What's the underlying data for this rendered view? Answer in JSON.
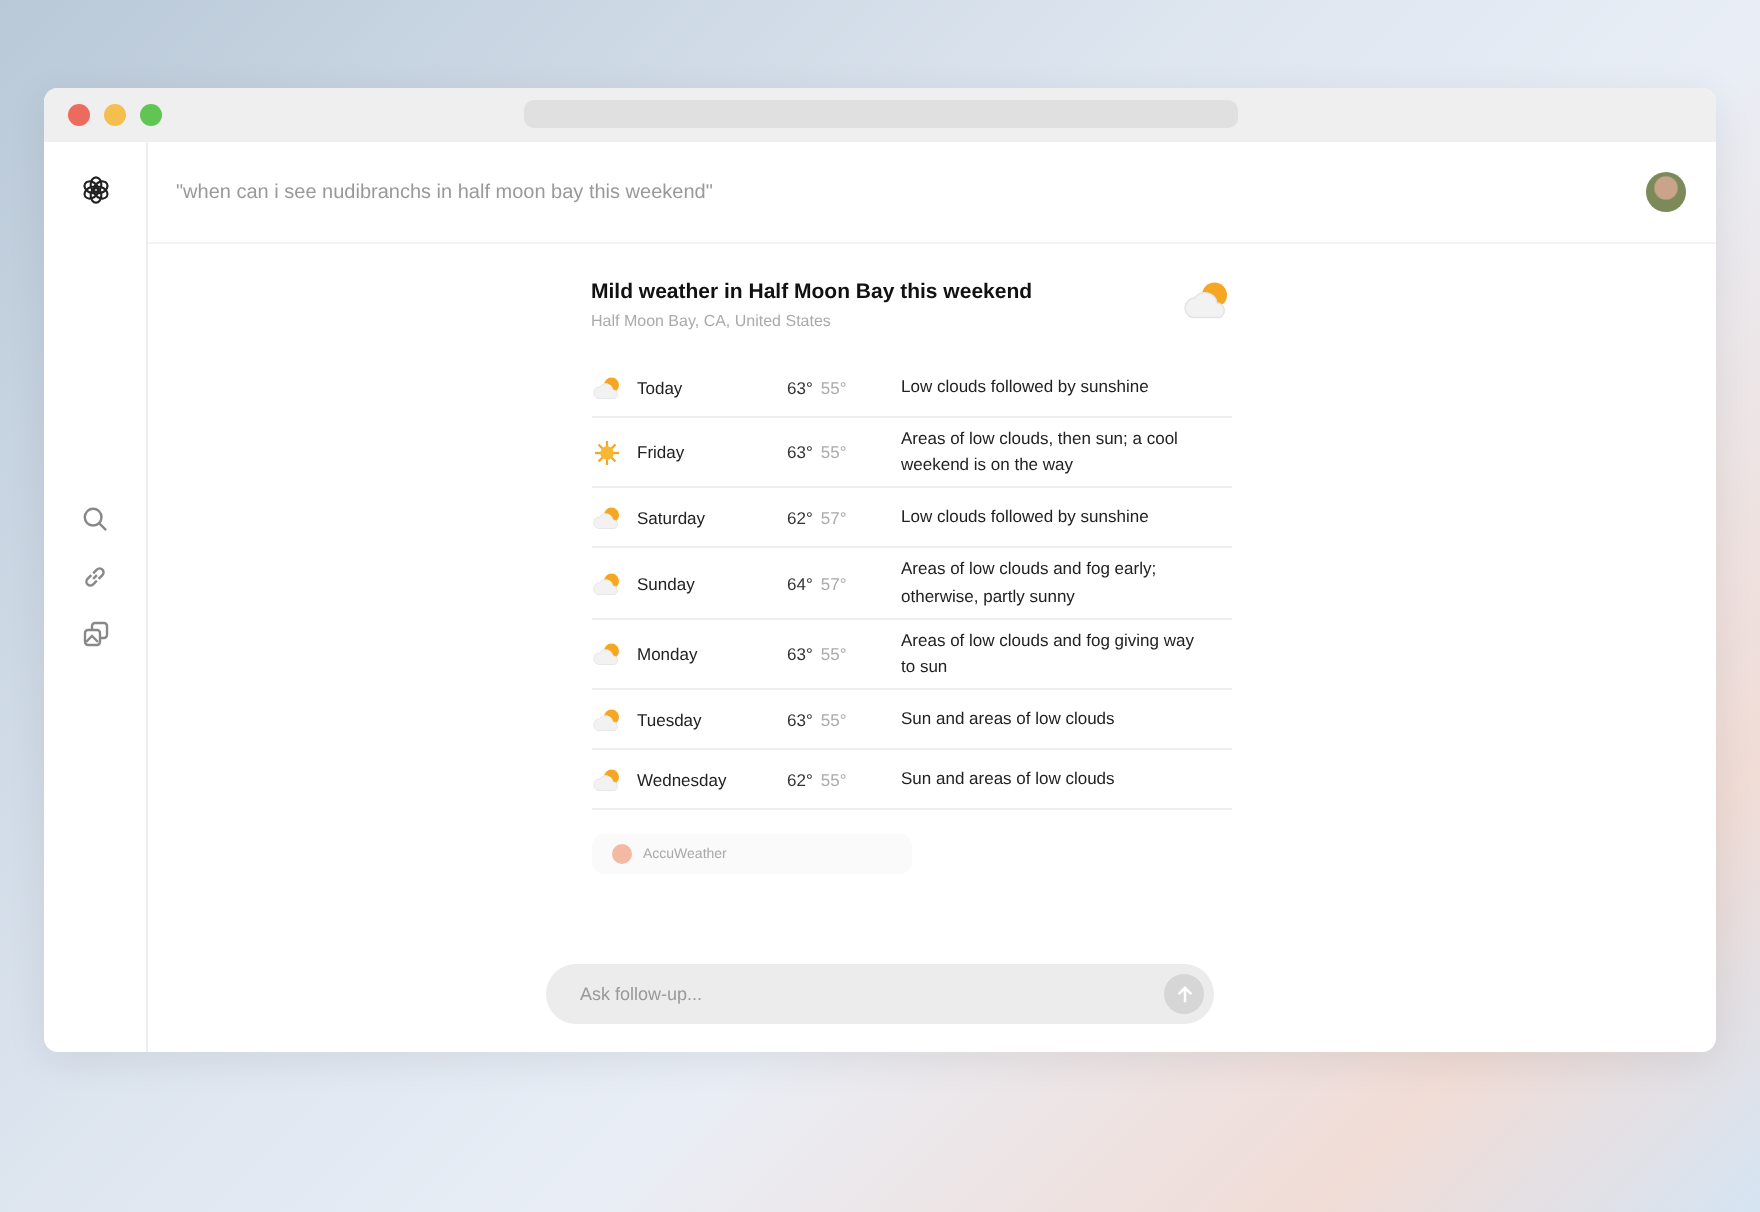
{
  "query": "\"when can i see nudibranchs in half moon bay this weekend\"",
  "card": {
    "title": "Mild weather in Half Moon Bay this weekend",
    "location": "Half Moon Bay, CA, United States",
    "kind": "partly_cloudy"
  },
  "forecast": [
    {
      "day": "Today",
      "high": "63°",
      "low": "55°",
      "summary": "Low clouds followed by sunshine",
      "kind": "partly_cloudy"
    },
    {
      "day": "Friday",
      "high": "63°",
      "low": "55°",
      "summary": "Areas of low clouds, then sun; a cool weekend is on the way",
      "kind": "sunny"
    },
    {
      "day": "Saturday",
      "high": "62°",
      "low": "57°",
      "summary": "Low clouds followed by sunshine",
      "kind": "partly_cloudy"
    },
    {
      "day": "Sunday",
      "high": "64°",
      "low": "57°",
      "summary": "Areas of low clouds and fog early; otherwise, partly sunny",
      "kind": "partly_cloudy"
    },
    {
      "day": "Monday",
      "high": "63°",
      "low": "55°",
      "summary": "Areas of low clouds and fog giving way to sun",
      "kind": "partly_cloudy"
    },
    {
      "day": "Tuesday",
      "high": "63°",
      "low": "55°",
      "summary": "Sun and areas of low clouds",
      "kind": "partly_cloudy"
    },
    {
      "day": "Wednesday",
      "high": "62°",
      "low": "55°",
      "summary": "Sun and areas of low clouds",
      "kind": "partly_cloudy"
    }
  ],
  "source": "AccuWeather",
  "followup": {
    "placeholder": "Ask follow-up..."
  }
}
